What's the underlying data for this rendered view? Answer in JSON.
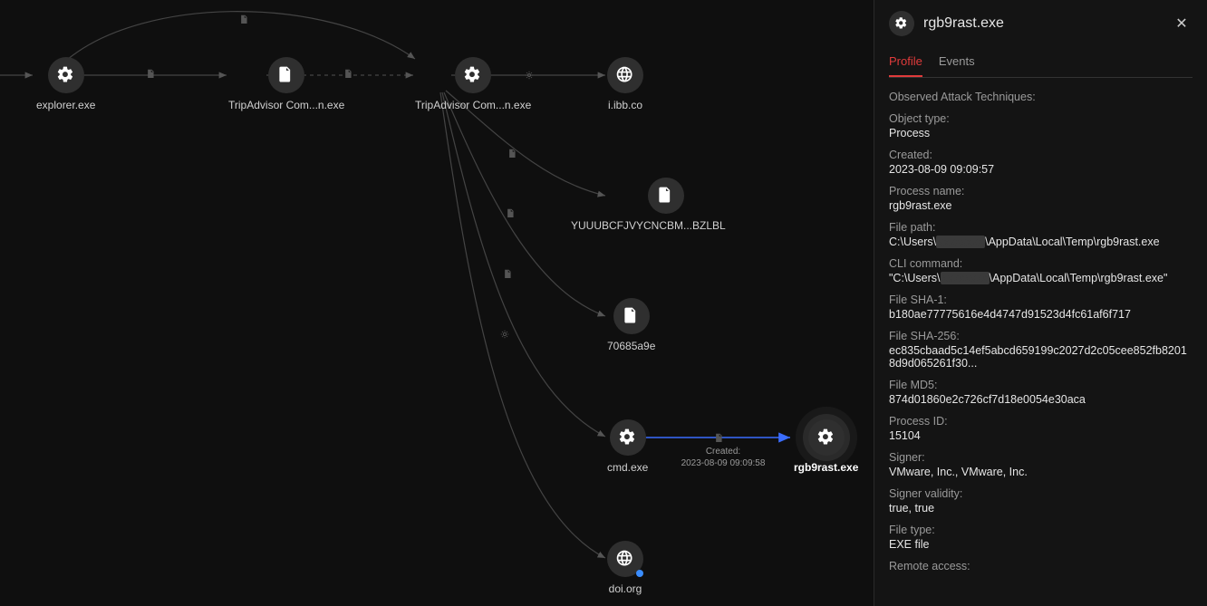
{
  "nodes": {
    "explorer": {
      "label": "explorer.exe",
      "type": "gear"
    },
    "trip1": {
      "label": "TripAdvisor Com...n.exe",
      "type": "doc"
    },
    "trip2": {
      "label": "TripAdvisor Com...n.exe",
      "type": "gear"
    },
    "iibb": {
      "label": "i.ibb.co",
      "type": "globe"
    },
    "yuu": {
      "label": "YUUUBCFJVYCNCBM...BZLBL",
      "type": "doc"
    },
    "hex": {
      "label": "70685a9e",
      "type": "doc"
    },
    "cmd": {
      "label": "cmd.exe",
      "type": "gear"
    },
    "rgb": {
      "label": "rgb9rast.exe",
      "type": "gear"
    },
    "doi": {
      "label": "doi.org",
      "type": "globe"
    }
  },
  "edge_cmd_rgb": {
    "label_top": "Created:",
    "label_bottom": "2023-08-09 09:09:58"
  },
  "panel": {
    "title": "rgb9rast.exe",
    "tabs": {
      "profile": "Profile",
      "events": "Events"
    },
    "sections": {
      "observed": "Observed Attack Techniques:",
      "object_type_l": "Object type:",
      "object_type_v": "Process",
      "created_l": "Created:",
      "created_v": "2023-08-09 09:09:57",
      "pname_l": "Process name:",
      "pname_v": "rgb9rast.exe",
      "fpath_l": "File path:",
      "fpath_pre": "C:\\Users\\",
      "fpath_post": "\\AppData\\Local\\Temp\\rgb9rast.exe",
      "cli_l": "CLI command:",
      "cli_pre": "\"C:\\Users\\",
      "cli_post": "\\AppData\\Local\\Temp\\rgb9rast.exe\"",
      "sha1_l": "File SHA-1:",
      "sha1_v": "b180ae77775616e4d4747d91523d4fc61af6f717",
      "sha256_l": "File SHA-256:",
      "sha256_v": "ec835cbaad5c14ef5abcd659199c2027d2c05cee852fb82018d9d065261f30...",
      "md5_l": "File MD5:",
      "md5_v": "874d01860e2c726cf7d18e0054e30aca",
      "pid_l": "Process ID:",
      "pid_v": "15104",
      "signer_l": "Signer:",
      "signer_v": "VMware, Inc., VMware, Inc.",
      "sigval_l": "Signer validity:",
      "sigval_v": "true, true",
      "ftype_l": "File type:",
      "ftype_v": "EXE file",
      "remote_l": "Remote access:"
    }
  }
}
